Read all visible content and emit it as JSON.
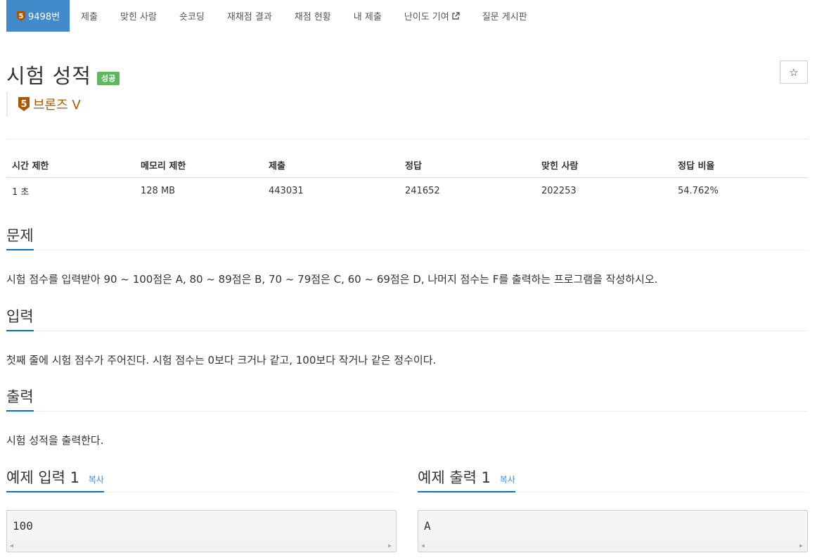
{
  "nav": {
    "problem_id_tab": "9498번",
    "tabs": [
      "제출",
      "맞힌 사람",
      "숏코딩",
      "재채점 결과",
      "채점 현황",
      "내 제출",
      "난이도 기여",
      "질문 게시판"
    ],
    "tier_number": "5"
  },
  "problem": {
    "title": "시험 성적",
    "status_badge": "성공",
    "star": "☆",
    "tier_label": "브론즈 V",
    "tier_number": "5"
  },
  "info_table": {
    "headers": [
      "시간 제한",
      "메모리 제한",
      "제출",
      "정답",
      "맞힌 사람",
      "정답 비율"
    ],
    "values": [
      "1 초",
      "128 MB",
      "443031",
      "241652",
      "202253",
      "54.762%"
    ]
  },
  "sections": {
    "description_title": "문제",
    "description_text": "시험 점수를 입력받아 90 ~ 100점은 A, 80 ~ 89점은 B, 70 ~ 79점은 C, 60 ~ 69점은 D, 나머지 점수는 F를 출력하는 프로그램을 작성하시오.",
    "input_title": "입력",
    "input_text": "첫째 줄에 시험 점수가 주어진다. 시험 점수는 0보다 크거나 같고, 100보다 작거나 같은 정수이다.",
    "output_title": "출력",
    "output_text": "시험 성적을 출력한다."
  },
  "samples": {
    "input_title": "예제 입력 1",
    "output_title": "예제 출력 1",
    "copy_label": "복사",
    "input_value": "100",
    "output_value": "A"
  },
  "colors": {
    "active_tab": "#428bca",
    "success_badge": "#5cb85c",
    "bronze": "#ad5600",
    "section_underline": "#0076c0"
  }
}
